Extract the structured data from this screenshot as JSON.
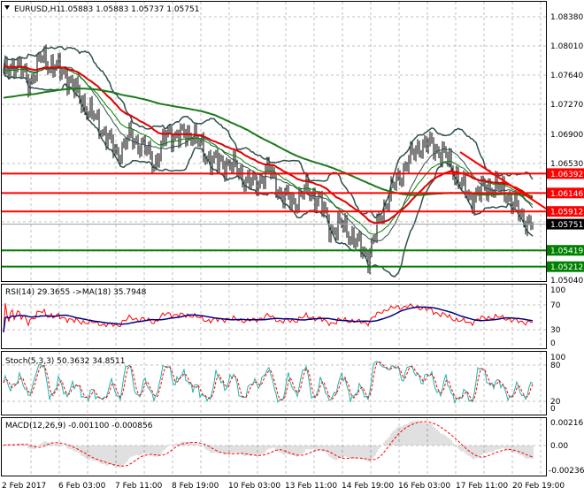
{
  "header": {
    "symbol_label": "EURUSD,H1",
    "ohlc": "1.05883 1.05883 1.05737 1.05751"
  },
  "price_axis": [
    "1.08380",
    "1.08010",
    "1.07640",
    "1.07270",
    "1.06900",
    "1.06530",
    "1.05040"
  ],
  "levels": [
    {
      "value": 1.06392,
      "label": "1.06392",
      "color": "#ff0000",
      "kind": "resistance"
    },
    {
      "value": 1.06146,
      "label": "1.06146",
      "color": "#ff0000",
      "kind": "resistance"
    },
    {
      "value": 1.05912,
      "label": "1.05912",
      "color": "#ff0000",
      "kind": "resistance"
    },
    {
      "value": 1.05751,
      "label": "1.05751",
      "color": "#000000",
      "kind": "current"
    },
    {
      "value": 1.05419,
      "label": "1.05419",
      "color": "#008000",
      "kind": "support"
    },
    {
      "value": 1.05212,
      "label": "1.05212",
      "color": "#008000",
      "kind": "support"
    }
  ],
  "rsi": {
    "label": "RSI(14) 29.3655  ->MA(18) 35.7948",
    "axis": [
      "100",
      "70",
      "30",
      "0"
    ]
  },
  "stoch": {
    "label": "Stoch(5,3,3) 50.3632 34.8511",
    "axis": [
      "100",
      "80",
      "20",
      "0"
    ]
  },
  "macd": {
    "label": "MACD(12,26,9) -0.001100 -0.000856",
    "axis": [
      "0.002161",
      "0.00",
      "-0.002368"
    ]
  },
  "time_axis": [
    "2 Feb 2017",
    "6 Feb 03:00",
    "7 Feb 11:00",
    "8 Feb 19:00",
    "10 Feb 03:00",
    "13 Feb 11:00",
    "14 Feb 19:00",
    "16 Feb 03:00",
    "17 Feb 11:00",
    "20 Feb 19:00"
  ],
  "chart_data": {
    "type": "candlestick",
    "title": "EURUSD,H1",
    "ylim": [
      1.0504,
      1.0838
    ],
    "price_path": [
      1.0764,
      1.0781,
      1.0753,
      1.0786,
      1.0775,
      1.0764,
      1.0736,
      1.0714,
      1.0691,
      1.0663,
      1.0686,
      1.0675,
      1.0652,
      1.0691,
      1.0686,
      1.0691,
      1.0663,
      1.0652,
      1.0652,
      1.0635,
      1.0624,
      1.0646,
      1.0613,
      1.0602,
      1.0619,
      1.0607,
      1.0568,
      1.0574,
      1.0551,
      1.0534,
      1.059,
      1.0624,
      1.0652,
      1.0675,
      1.0675,
      1.0663,
      1.0635,
      1.0607,
      1.0619,
      1.0624,
      1.0613,
      1.0585,
      1.0575
    ],
    "indicators": [
      "Bollinger Bands(20,2)",
      "MA red",
      "MA green",
      "RSI(14)",
      "Stoch(5,3,3)",
      "MACD(12,26,9)"
    ]
  }
}
